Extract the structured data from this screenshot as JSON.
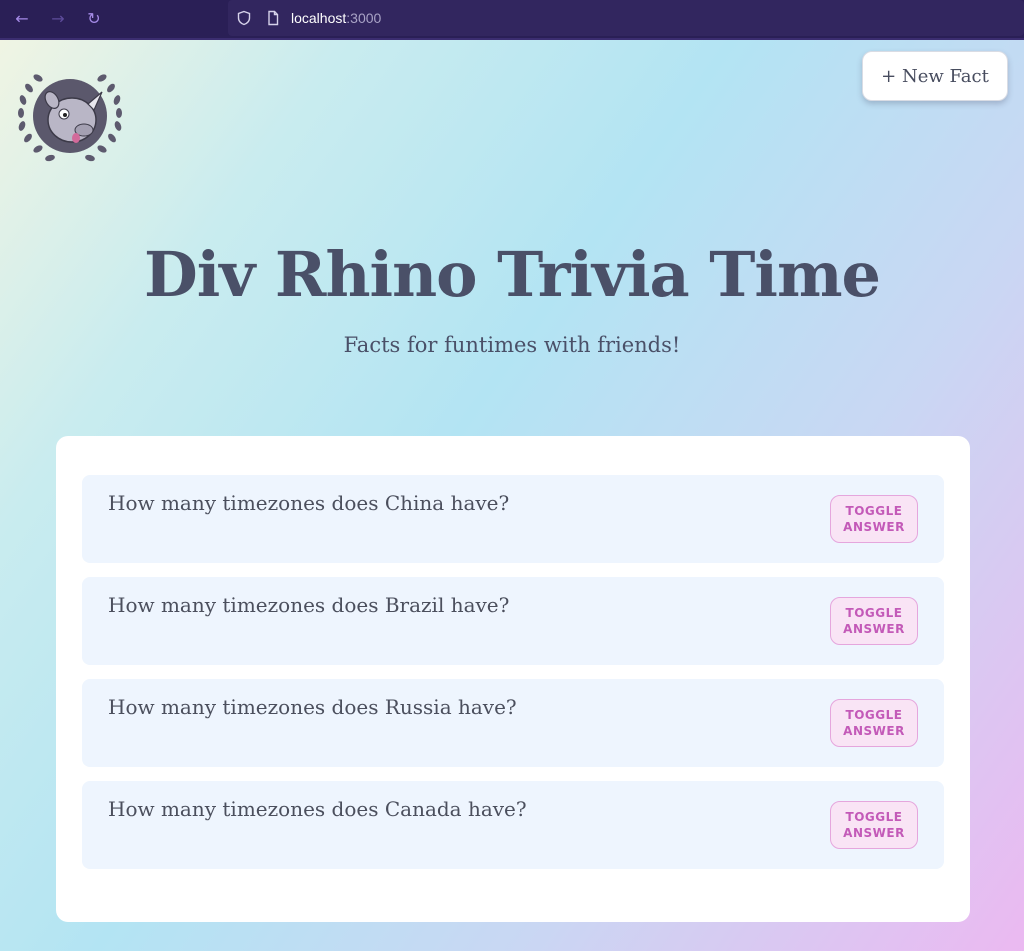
{
  "browser": {
    "url_host": "localhost",
    "url_port": ":3000"
  },
  "header": {
    "new_fact_label": "+ New Fact",
    "title": "Div Rhino Trivia Time",
    "subtitle": "Facts for funtimes with friends!"
  },
  "facts": [
    {
      "question": "How many timezones does China have?",
      "toggle_label": "TOGGLE ANSWER"
    },
    {
      "question": "How many timezones does Brazil have?",
      "toggle_label": "TOGGLE ANSWER"
    },
    {
      "question": "How many timezones does Russia have?",
      "toggle_label": "TOGGLE ANSWER"
    },
    {
      "question": "How many timezones does Canada have?",
      "toggle_label": "TOGGLE ANSWER"
    }
  ],
  "icons": {
    "back": "back-arrow-icon",
    "forward": "forward-arrow-icon",
    "reload": "reload-icon",
    "shield": "shield-icon",
    "page": "page-icon",
    "logo": "rhino-logo"
  },
  "colors": {
    "accent": "#c35ab8",
    "title": "#4a5068",
    "card_item_bg": "#eef5fe"
  }
}
